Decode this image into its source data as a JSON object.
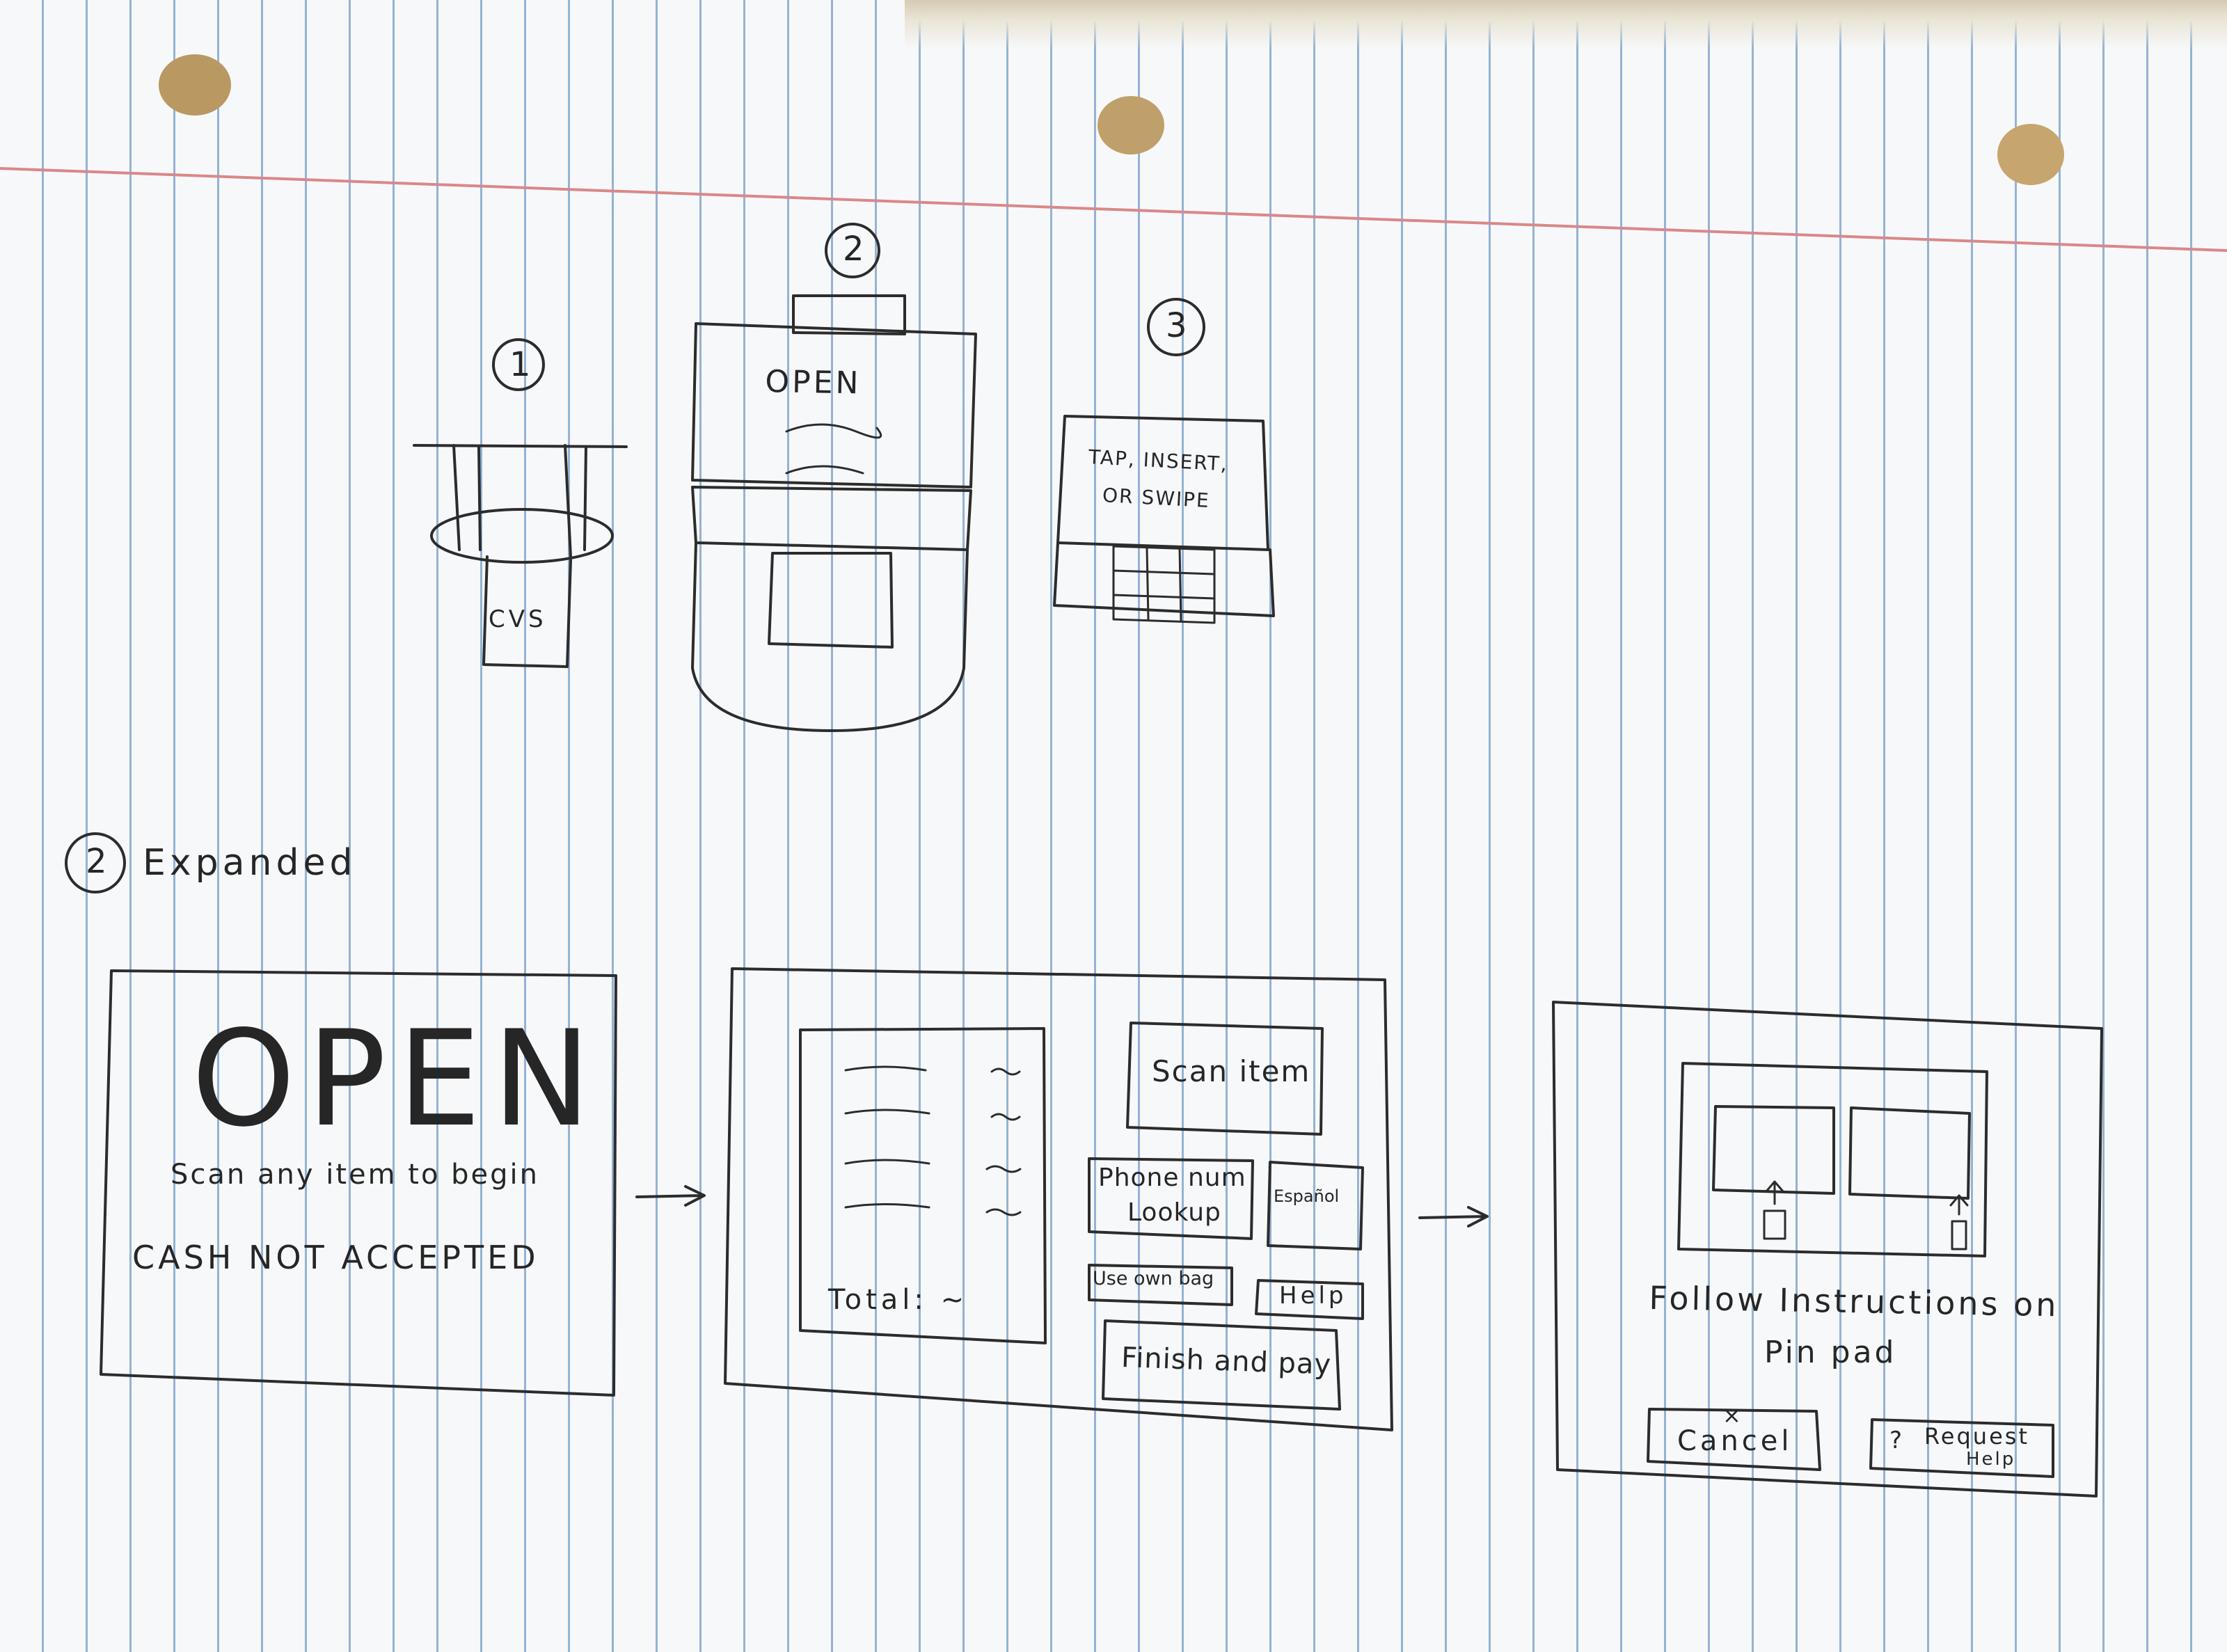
{
  "page": {
    "paper_line_color": "#93b3d4",
    "margin_line_color": "#d9888a",
    "hole_color": "#b99862",
    "ink_color": "#2c2c2c"
  },
  "overview": {
    "step1": {
      "number": "1",
      "sign": "CVS"
    },
    "step2": {
      "number": "2",
      "screen": "OPEN"
    },
    "step3": {
      "number": "3",
      "screen_line1": "TAP, INSERT,",
      "screen_line2": "OR SWIPE"
    }
  },
  "expanded": {
    "heading_number": "2",
    "heading": "Expanded",
    "welcome": {
      "title": "OPEN",
      "subtitle": "Scan any item to begin",
      "notice": "CASH NOT ACCEPTED"
    },
    "checkout": {
      "total_label": "Total: ~",
      "scan_item": "Scan item",
      "phone_lookup_line1": "Phone num",
      "phone_lookup_line2": "Lookup",
      "espanol": "Español",
      "use_own_bag": "Use own bag",
      "help": "Help",
      "finish_and_pay": "Finish and pay"
    },
    "payment": {
      "instructions_line1": "Follow Instructions on",
      "instructions_line2": "Pin pad",
      "cancel_icon": "x-icon",
      "cancel": "Cancel",
      "request_help_icon": "question-icon",
      "request_help_line1": "Request",
      "request_help_line2": "Help"
    }
  }
}
